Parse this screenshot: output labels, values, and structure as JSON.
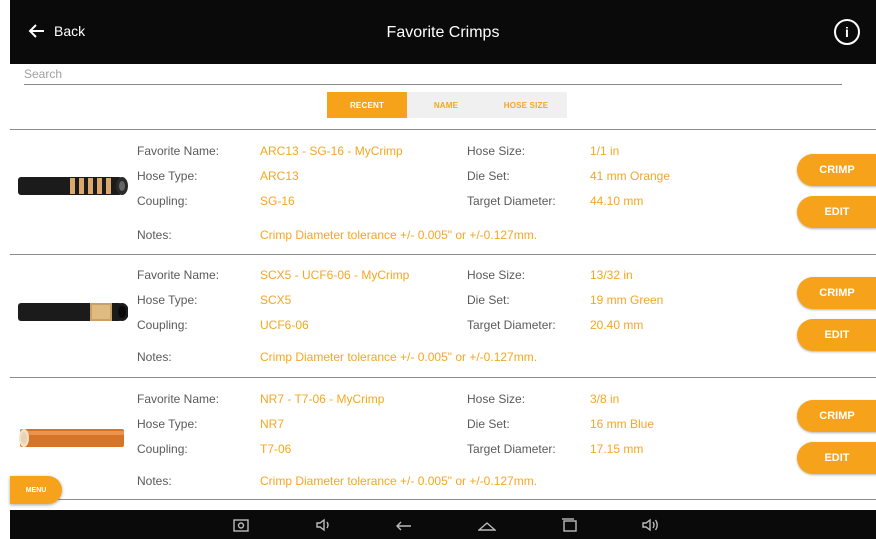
{
  "header": {
    "back_label": "Back",
    "title": "Favorite Crimps",
    "info_icon": "info-icon"
  },
  "search": {
    "placeholder": "Search",
    "value": ""
  },
  "tabs": [
    {
      "label": "RECENT",
      "active": true
    },
    {
      "label": "NAME",
      "active": false
    },
    {
      "label": "HOSE SIZE",
      "active": false
    }
  ],
  "field_labels": {
    "favorite_name": "Favorite Name:",
    "hose_type": "Hose Type:",
    "coupling": "Coupling:",
    "notes": "Notes:",
    "hose_size": "Hose Size:",
    "die_set": "Die Set:",
    "target_diameter": "Target Diameter:"
  },
  "crimps": [
    {
      "favorite_name": "ARC13 - SG-16 - MyCrimp",
      "hose_type": "ARC13",
      "coupling": "SG-16",
      "notes": "Crimp Diameter tolerance +/- 0.005\" or +/-0.127mm.",
      "hose_size": "1/1 in",
      "die_set": "41 mm Orange",
      "target_diameter": "44.10 mm",
      "crimp_label": "CRIMP",
      "edit_label": "EDIT",
      "image_icon": "spiral-hose-image"
    },
    {
      "favorite_name": "SCX5 - UCF6-06 - MyCrimp",
      "hose_type": "SCX5",
      "coupling": "UCF6-06",
      "notes": "Crimp Diameter tolerance +/- 0.005\" or +/-0.127mm.",
      "hose_size": "13/32 in",
      "die_set": "19 mm Green",
      "target_diameter": "20.40 mm",
      "crimp_label": "CRIMP",
      "edit_label": "EDIT",
      "image_icon": "braided-hose-image"
    },
    {
      "favorite_name": "NR7 - T7-06 - MyCrimp",
      "hose_type": "NR7",
      "coupling": "T7-06",
      "notes": "Crimp Diameter tolerance +/- 0.005\" or +/-0.127mm.",
      "hose_size": "3/8 in",
      "die_set": "16 mm Blue",
      "target_diameter": "17.15 mm",
      "crimp_label": "CRIMP",
      "edit_label": "EDIT",
      "image_icon": "orange-hose-image"
    }
  ],
  "menu": {
    "label": "MENU"
  },
  "navbar": {
    "icons": [
      "screenshot-icon",
      "volume-down-icon",
      "back-icon",
      "home-icon",
      "recent-apps-icon",
      "volume-up-icon"
    ]
  },
  "colors": {
    "accent": "#f7a21b",
    "value_text": "#f5a623",
    "label_text": "#5a5a5a",
    "bar": "#0a0a0a"
  }
}
